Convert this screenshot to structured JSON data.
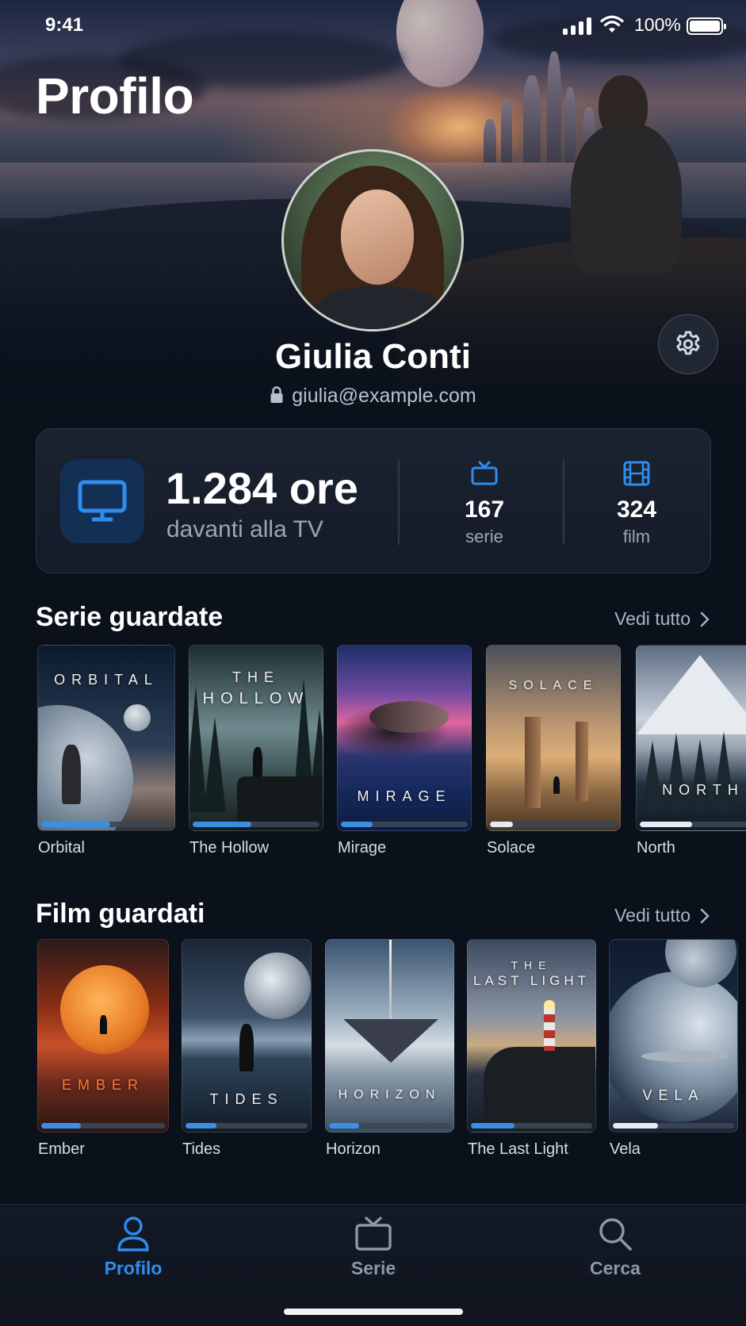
{
  "status_bar": {
    "time": "9:41",
    "battery": "100%"
  },
  "page": {
    "title": "Profilo"
  },
  "profile": {
    "name": "Giulia Conti",
    "email": "giulia@example.com"
  },
  "stats": {
    "hours_value": "1.284 ore",
    "hours_caption": "davanti alla TV",
    "series_count": "167",
    "series_label": "serie",
    "films_count": "324",
    "films_label": "film"
  },
  "series_section": {
    "title": "Serie guardate",
    "see_all": "Vedi tutto",
    "items": [
      {
        "label": "Orbital",
        "poster_text": "ORBITAL",
        "progress": 0.53
      },
      {
        "label": "The Hollow",
        "poster_text_top": "THE",
        "poster_text": "HOLLOW",
        "progress": 0.46
      },
      {
        "label": "Mirage",
        "poster_text": "MIRAGE",
        "progress": 0.25
      },
      {
        "label": "Solace",
        "poster_text": "SOLACE",
        "progress": 0.18
      },
      {
        "label": "North",
        "poster_text": "NORTH",
        "progress": 0.41
      }
    ]
  },
  "films_section": {
    "title": "Film guardati",
    "see_all": "Vedi tutto",
    "items": [
      {
        "label": "Ember",
        "poster_text": "EMBER",
        "progress": 0.32
      },
      {
        "label": "Tides",
        "poster_text": "TIDES",
        "progress": 0.25
      },
      {
        "label": "Horizon",
        "poster_text": "HORIZON",
        "progress": 0.25
      },
      {
        "label": "The Last Light",
        "poster_text_top": "THE",
        "poster_text": "LAST LIGHT",
        "progress": 0.36
      },
      {
        "label": "Vela",
        "poster_text": "VELA",
        "progress": 0.37
      }
    ]
  },
  "tabbar": {
    "items": [
      {
        "label": "Profilo",
        "icon": "person-icon",
        "active": true
      },
      {
        "label": "Serie",
        "icon": "tv-icon",
        "active": false
      },
      {
        "label": "Cerca",
        "icon": "search-icon",
        "active": false
      }
    ]
  },
  "colors": {
    "accent": "#2f8df0",
    "background": "#0b111b",
    "card": "#171e2b"
  }
}
